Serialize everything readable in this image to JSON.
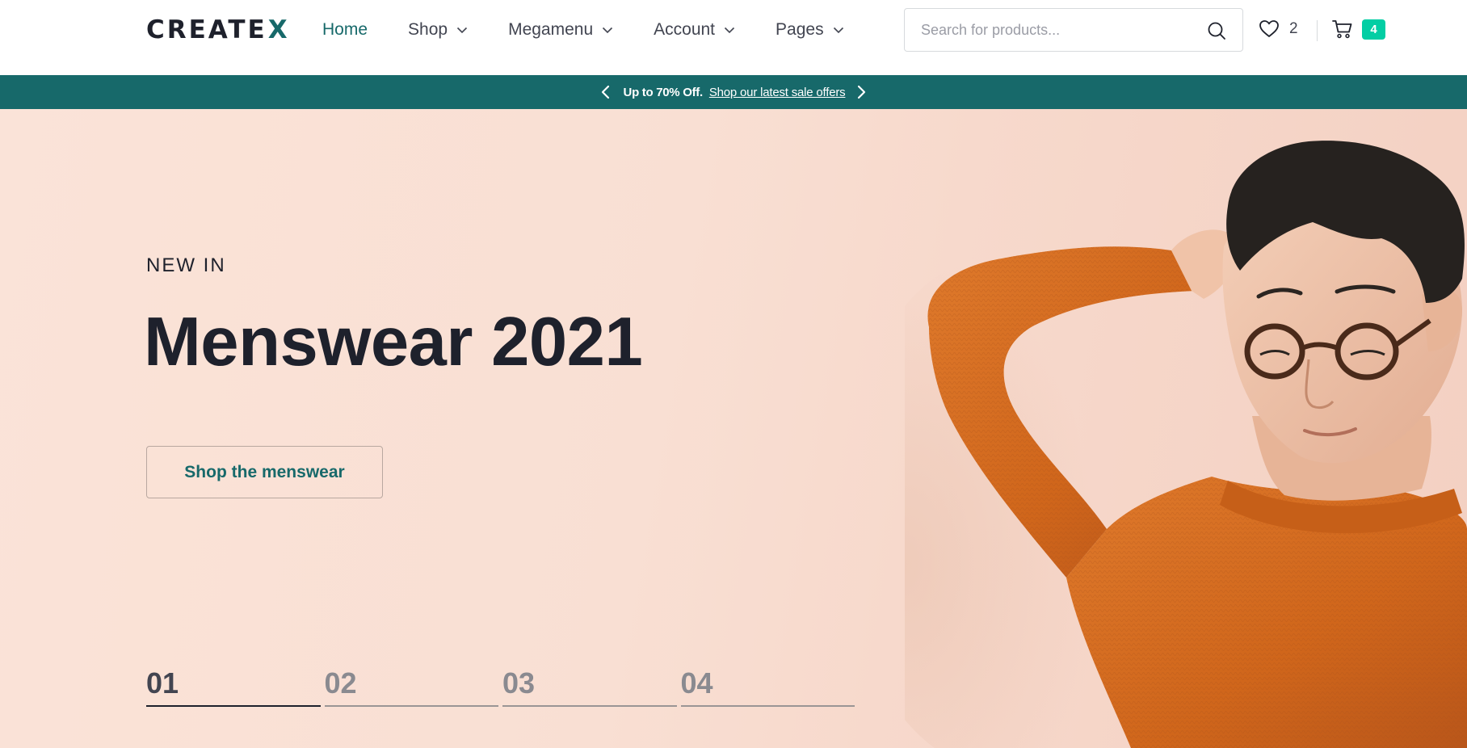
{
  "brand": {
    "logo_text": "CREATE",
    "logo_accent": "X"
  },
  "nav": {
    "items": [
      {
        "label": "Home",
        "active": true,
        "has_dropdown": false
      },
      {
        "label": "Shop",
        "active": false,
        "has_dropdown": true
      },
      {
        "label": "Megamenu",
        "active": false,
        "has_dropdown": true
      },
      {
        "label": "Account",
        "active": false,
        "has_dropdown": true
      },
      {
        "label": "Pages",
        "active": false,
        "has_dropdown": true
      }
    ]
  },
  "search": {
    "placeholder": "Search for products...",
    "value": "",
    "icon": "search-icon"
  },
  "wishlist": {
    "icon": "heart-icon",
    "count": "2"
  },
  "cart": {
    "icon": "cart-icon",
    "count": "4"
  },
  "promo": {
    "bold_text": "Up to 70% Off.",
    "link_text": "Shop our latest sale offers",
    "prev_icon": "chevron-left-icon",
    "next_icon": "chevron-right-icon"
  },
  "hero": {
    "eyebrow": "NEW IN",
    "title": "Menswear 2021",
    "cta_label": "Shop the menswear",
    "slides": [
      {
        "label": "01",
        "active": true
      },
      {
        "label": "02",
        "active": false
      },
      {
        "label": "03",
        "active": false
      },
      {
        "label": "04",
        "active": false
      }
    ]
  },
  "colors": {
    "primary": "#17696a",
    "dark": "#1e212c",
    "body_text": "#424551",
    "badge": "#03cea4",
    "hero_bg": "#fae3d8",
    "sweater": "#d66b1c"
  }
}
